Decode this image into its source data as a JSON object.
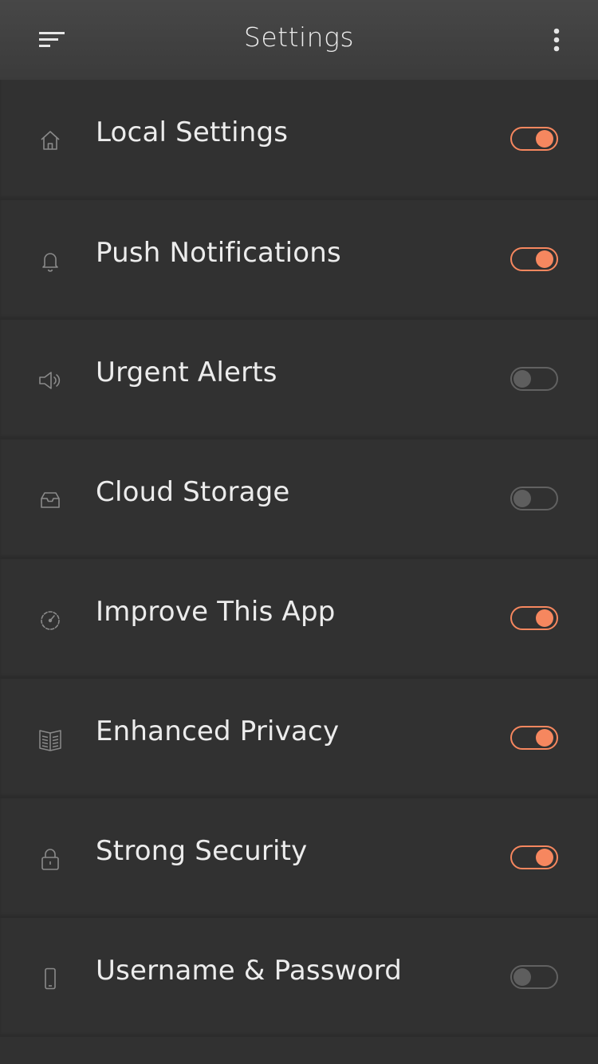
{
  "header": {
    "title": "Settings"
  },
  "colors": {
    "accent": "#f6875f",
    "toggle_off": "#5e5e5e",
    "background": "#313131"
  },
  "settings": [
    {
      "label": "Local Settings",
      "icon": "home-icon",
      "enabled": true
    },
    {
      "label": "Push Notifications",
      "icon": "bell-icon",
      "enabled": true
    },
    {
      "label": "Urgent Alerts",
      "icon": "speaker-icon",
      "enabled": false
    },
    {
      "label": "Cloud Storage",
      "icon": "inbox-tray-icon",
      "enabled": false
    },
    {
      "label": "Improve This App",
      "icon": "speedometer-icon",
      "enabled": true
    },
    {
      "label": "Enhanced Privacy",
      "icon": "book-icon",
      "enabled": true
    },
    {
      "label": "Strong Security",
      "icon": "lock-icon",
      "enabled": true
    },
    {
      "label": "Username & Password",
      "icon": "phone-icon",
      "enabled": false
    }
  ]
}
